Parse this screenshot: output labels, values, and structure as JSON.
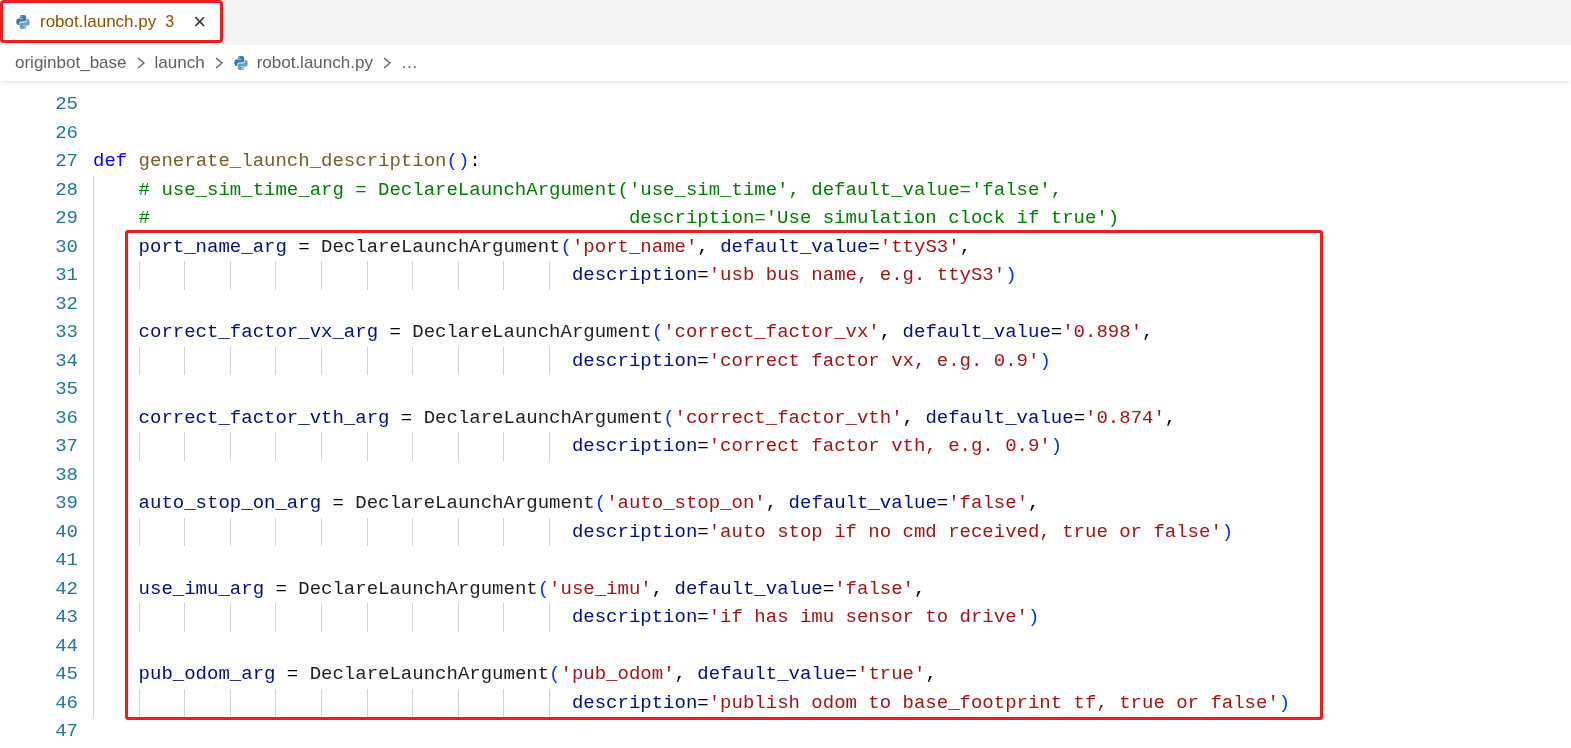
{
  "tab": {
    "label": "robot.launch.py",
    "problems": "3",
    "close": "×",
    "framed": true
  },
  "breadcrumbs": [
    {
      "label": "originbot_base",
      "kind": "folder"
    },
    {
      "label": "launch",
      "kind": "folder"
    },
    {
      "label": "robot.launch.py",
      "kind": "file"
    },
    {
      "label": "…",
      "kind": "more"
    }
  ],
  "sections": [
    {
      "framed": false,
      "lines": [
        {
          "number": "25"
        },
        {
          "number": "26"
        },
        {
          "number": "27",
          "tokens": [
            {
              "kind": "kw",
              "text": "def"
            },
            {
              "kind": "fn",
              "text": " generate_launch_description"
            },
            {
              "kind": "br",
              "text": "()"
            },
            {
              "kind": "op",
              "text": ":"
            }
          ]
        },
        {
          "number": "28",
          "tokens": [
            {
              "kind": "cm",
              "text": "    # use_sim_time_arg = DeclareLaunchArgument('use_sim_time', default_value='false',"
            }
          ]
        },
        {
          "number": "29",
          "tokens": [
            {
              "kind": "cm",
              "text": "    #                                          description='Use simulation clock if true')"
            }
          ]
        }
      ]
    },
    {
      "framed": true,
      "lines": [
        {
          "number": "30",
          "tokens": [
            {
              "kind": "var",
              "text": "    port_name_arg"
            },
            {
              "kind": "op",
              "text": " = "
            },
            {
              "kind": "cls",
              "text": "DeclareLaunchArgument"
            },
            {
              "kind": "br",
              "text": "("
            },
            {
              "kind": "str",
              "text": "'port_name'"
            },
            {
              "kind": "op",
              "text": ", "
            },
            {
              "kind": "var",
              "text": "default_value"
            },
            {
              "kind": "op",
              "text": "="
            },
            {
              "kind": "str",
              "text": "'ttyS3'"
            },
            {
              "kind": "op",
              "text": ","
            }
          ]
        },
        {
          "number": "31",
          "tokens": [
            {
              "kind": "var",
              "text": "                                          description"
            },
            {
              "kind": "op",
              "text": "="
            },
            {
              "kind": "str",
              "text": "'usb bus name, e.g. ttyS3'"
            },
            {
              "kind": "br",
              "text": ")"
            }
          ]
        },
        {
          "number": "32"
        },
        {
          "number": "33",
          "tokens": [
            {
              "kind": "var",
              "text": "    correct_factor_vx_arg"
            },
            {
              "kind": "op",
              "text": " = "
            },
            {
              "kind": "cls",
              "text": "DeclareLaunchArgument"
            },
            {
              "kind": "br",
              "text": "("
            },
            {
              "kind": "str",
              "text": "'correct_factor_vx'"
            },
            {
              "kind": "op",
              "text": ", "
            },
            {
              "kind": "var",
              "text": "default_value"
            },
            {
              "kind": "op",
              "text": "="
            },
            {
              "kind": "str",
              "text": "'0.898'"
            },
            {
              "kind": "op",
              "text": ","
            }
          ]
        },
        {
          "number": "34",
          "tokens": [
            {
              "kind": "var",
              "text": "                                          description"
            },
            {
              "kind": "op",
              "text": "="
            },
            {
              "kind": "str",
              "text": "'correct factor vx, e.g. 0.9'"
            },
            {
              "kind": "br",
              "text": ")"
            }
          ]
        },
        {
          "number": "35"
        },
        {
          "number": "36",
          "tokens": [
            {
              "kind": "var",
              "text": "    correct_factor_vth_arg"
            },
            {
              "kind": "op",
              "text": " = "
            },
            {
              "kind": "cls",
              "text": "DeclareLaunchArgument"
            },
            {
              "kind": "br",
              "text": "("
            },
            {
              "kind": "str",
              "text": "'correct_factor_vth'"
            },
            {
              "kind": "op",
              "text": ", "
            },
            {
              "kind": "var",
              "text": "default_value"
            },
            {
              "kind": "op",
              "text": "="
            },
            {
              "kind": "str",
              "text": "'0.874'"
            },
            {
              "kind": "op",
              "text": ","
            }
          ]
        },
        {
          "number": "37",
          "tokens": [
            {
              "kind": "var",
              "text": "                                          description"
            },
            {
              "kind": "op",
              "text": "="
            },
            {
              "kind": "str",
              "text": "'correct factor vth, e.g. 0.9'"
            },
            {
              "kind": "br",
              "text": ")"
            }
          ]
        },
        {
          "number": "38"
        },
        {
          "number": "39",
          "tokens": [
            {
              "kind": "var",
              "text": "    auto_stop_on_arg"
            },
            {
              "kind": "op",
              "text": " = "
            },
            {
              "kind": "cls",
              "text": "DeclareLaunchArgument"
            },
            {
              "kind": "br",
              "text": "("
            },
            {
              "kind": "str",
              "text": "'auto_stop_on'"
            },
            {
              "kind": "op",
              "text": ", "
            },
            {
              "kind": "var",
              "text": "default_value"
            },
            {
              "kind": "op",
              "text": "="
            },
            {
              "kind": "str",
              "text": "'false'"
            },
            {
              "kind": "op",
              "text": ","
            }
          ]
        },
        {
          "number": "40",
          "tokens": [
            {
              "kind": "var",
              "text": "                                          description"
            },
            {
              "kind": "op",
              "text": "="
            },
            {
              "kind": "str",
              "text": "'auto stop if no cmd received, true or false'"
            },
            {
              "kind": "br",
              "text": ")"
            }
          ]
        },
        {
          "number": "41"
        },
        {
          "number": "42",
          "tokens": [
            {
              "kind": "var",
              "text": "    use_imu_arg"
            },
            {
              "kind": "op",
              "text": " = "
            },
            {
              "kind": "cls",
              "text": "DeclareLaunchArgument"
            },
            {
              "kind": "br",
              "text": "("
            },
            {
              "kind": "str",
              "text": "'use_imu'"
            },
            {
              "kind": "op",
              "text": ", "
            },
            {
              "kind": "var",
              "text": "default_value"
            },
            {
              "kind": "op",
              "text": "="
            },
            {
              "kind": "str",
              "text": "'false'"
            },
            {
              "kind": "op",
              "text": ","
            }
          ]
        },
        {
          "number": "43",
          "tokens": [
            {
              "kind": "var",
              "text": "                                          description"
            },
            {
              "kind": "op",
              "text": "="
            },
            {
              "kind": "str",
              "text": "'if has imu sensor to drive'"
            },
            {
              "kind": "br",
              "text": ")"
            }
          ]
        },
        {
          "number": "44"
        },
        {
          "number": "45",
          "tokens": [
            {
              "kind": "var",
              "text": "    pub_odom_arg"
            },
            {
              "kind": "op",
              "text": " = "
            },
            {
              "kind": "cls",
              "text": "DeclareLaunchArgument"
            },
            {
              "kind": "br",
              "text": "("
            },
            {
              "kind": "str",
              "text": "'pub_odom'"
            },
            {
              "kind": "op",
              "text": ", "
            },
            {
              "kind": "var",
              "text": "default_value"
            },
            {
              "kind": "op",
              "text": "="
            },
            {
              "kind": "str",
              "text": "'true'"
            },
            {
              "kind": "op",
              "text": ","
            }
          ]
        },
        {
          "number": "46",
          "tokens": [
            {
              "kind": "var",
              "text": "                                          description"
            },
            {
              "kind": "op",
              "text": "="
            },
            {
              "kind": "str",
              "text": "'publish odom to base_footprint tf, true or false'"
            },
            {
              "kind": "br",
              "text": ")"
            }
          ]
        }
      ]
    },
    {
      "framed": false,
      "lines": [
        {
          "number": "47"
        }
      ]
    }
  ]
}
